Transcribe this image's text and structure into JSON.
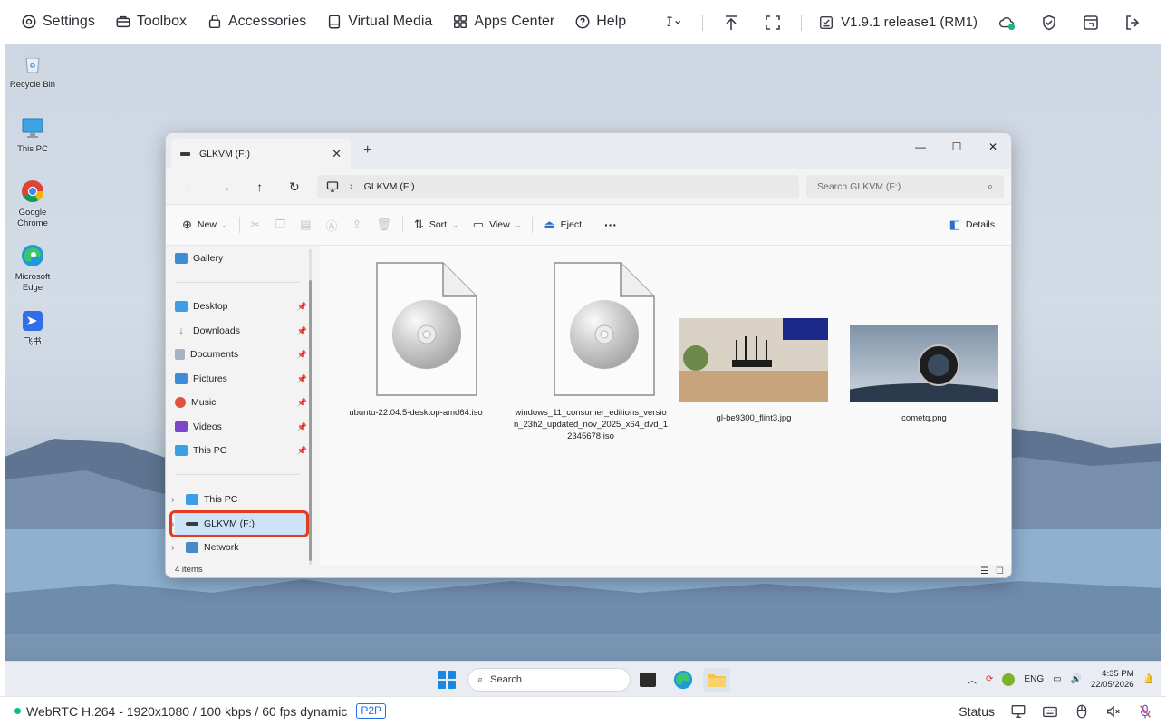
{
  "toolbar": {
    "settings": "Settings",
    "toolbox": "Toolbox",
    "accessories": "Accessories",
    "virtual_media": "Virtual Media",
    "apps_center": "Apps Center",
    "help": "Help",
    "version": "V1.9.1 release1 (RM1)",
    "cloud_status_color": "#19b97d"
  },
  "desktop": {
    "icons": [
      "Recycle Bin",
      "This PC",
      "Google Chrome",
      "Microsoft Edge",
      "飞书"
    ]
  },
  "explorer": {
    "tab_title": "GLKVM (F:)",
    "new_tab": "+",
    "address": "GLKVM (F:)",
    "search_placeholder": "Search GLKVM (F:)",
    "commands": {
      "new": "New",
      "sort": "Sort",
      "view": "View",
      "eject": "Eject",
      "more": "···",
      "details": "Details"
    },
    "sidebar": {
      "gallery": "Gallery",
      "quick_access": [
        "Desktop",
        "Downloads",
        "Documents",
        "Pictures",
        "Music",
        "Videos",
        "This PC"
      ],
      "this_pc": "This PC",
      "glkvm": "GLKVM (F:)",
      "network": "Network"
    },
    "files": [
      {
        "name": "ubuntu-22.04.5-desktop-amd64.iso",
        "kind": "disc-image"
      },
      {
        "name": "windows_11_consumer_editions_version_23h2_updated_nov_2025_x64_dvd_12345678.iso",
        "kind": "disc-image"
      },
      {
        "name": "gl-be9300_flint3.jpg",
        "kind": "photo"
      },
      {
        "name": "cometq.png",
        "kind": "photo"
      }
    ],
    "status": "4 items"
  },
  "taskbar": {
    "search": "Search",
    "lang": "ENG",
    "time": "4:35 PM",
    "date": "22/05/2026"
  },
  "bottom": {
    "stream": "WebRTC H.264 - 1920x1080 / 100 kbps / 60 fps dynamic",
    "p2p": "P2P",
    "status": "Status"
  }
}
